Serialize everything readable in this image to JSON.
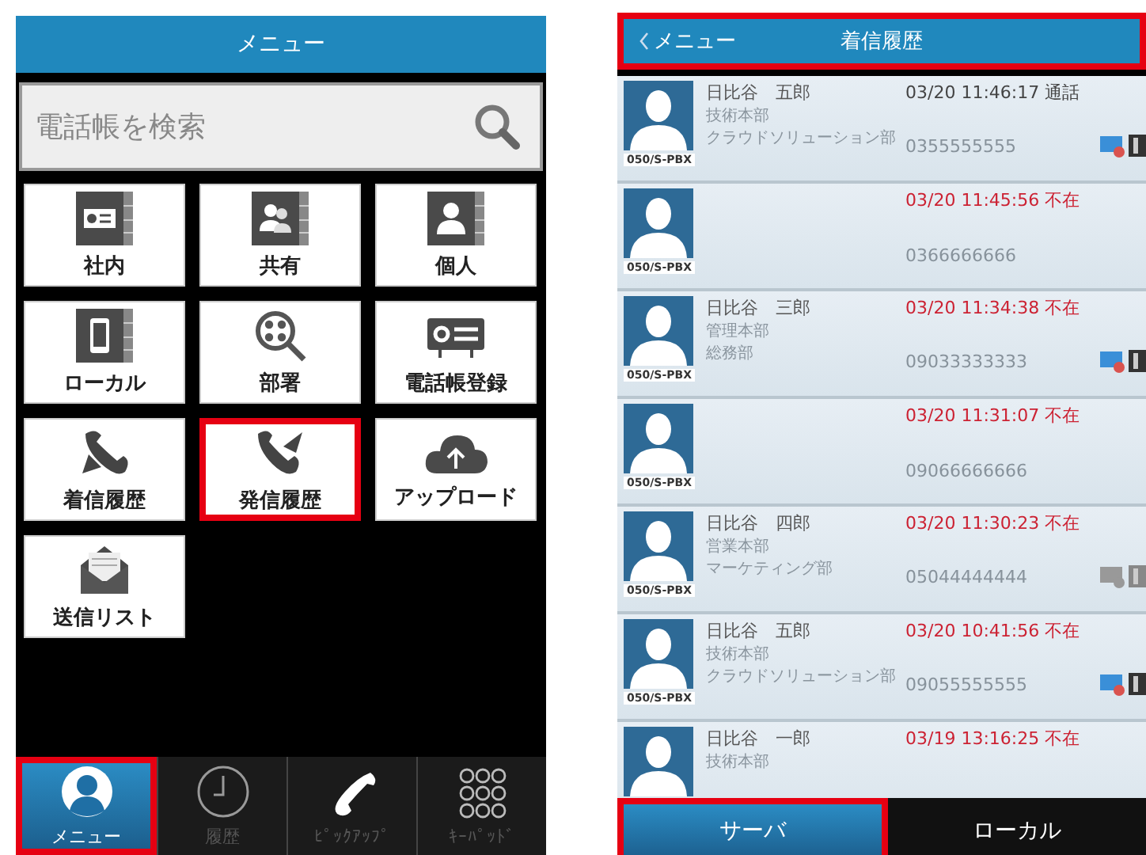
{
  "menu_screen": {
    "title": "メニュー",
    "search": {
      "placeholder": "電話帳を検索"
    },
    "tiles": [
      {
        "label": "社内",
        "highlighted": false
      },
      {
        "label": "共有",
        "highlighted": false
      },
      {
        "label": "個人",
        "highlighted": false
      },
      {
        "label": "ローカル",
        "highlighted": false
      },
      {
        "label": "部署",
        "highlighted": false
      },
      {
        "label": "電話帳登録",
        "highlighted": false
      },
      {
        "label": "着信履歴",
        "highlighted": false
      },
      {
        "label": "発信履歴",
        "highlighted": true
      },
      {
        "label": "アップロード",
        "highlighted": false
      },
      {
        "label": "送信リスト",
        "highlighted": false
      }
    ],
    "bottom_nav": [
      {
        "label": "メニュー",
        "selected": true,
        "highlighted": true
      },
      {
        "label": "履歴",
        "selected": false,
        "highlighted": false
      },
      {
        "label": "ﾋﾟｯｸｱｯﾌﾟ",
        "selected": false,
        "highlighted": false
      },
      {
        "label": "ｷｰﾊﾟｯﾄﾞ",
        "selected": false,
        "highlighted": false
      }
    ]
  },
  "history_screen": {
    "back": "メニュー",
    "title": "着信履歴",
    "header_highlighted": true,
    "rows": [
      {
        "name": "日比谷　五郎",
        "dept": "技術本部",
        "section": "クラウドソリューション部",
        "time": "03/20 11:46:17 通話",
        "missed": false,
        "number": "0355555555",
        "badge": "050/S-PBX",
        "status_icons": true,
        "online": true
      },
      {
        "time": "03/20 11:45:56 不在",
        "missed": true,
        "number": "0366666666",
        "badge": "050/S-PBX",
        "status_icons": false
      },
      {
        "name": "日比谷　三郎",
        "dept": "管理本部",
        "section": "総務部",
        "time": "03/20 11:34:38 不在",
        "missed": true,
        "number": "09033333333",
        "badge": "050/S-PBX",
        "status_icons": true,
        "online": true
      },
      {
        "time": "03/20 11:31:07 不在",
        "missed": true,
        "number": "09066666666",
        "badge": "050/S-PBX",
        "status_icons": false
      },
      {
        "name": "日比谷　四郎",
        "dept": "営業本部",
        "section": "マーケティング部",
        "time": "03/20 11:30:23 不在",
        "missed": true,
        "number": "05044444444",
        "badge": "050/S-PBX",
        "status_icons": true,
        "online": false
      },
      {
        "name": "日比谷　五郎",
        "dept": "技術本部",
        "section": "クラウドソリューション部",
        "time": "03/20 10:41:56 不在",
        "missed": true,
        "number": "09055555555",
        "badge": "050/S-PBX",
        "status_icons": true,
        "online": true
      },
      {
        "name": "日比谷　一郎",
        "dept": "技術本部",
        "time": "03/19 13:16:25 不在",
        "missed": true
      }
    ],
    "tabs": [
      {
        "label": "サーバ",
        "selected": true,
        "highlighted": true
      },
      {
        "label": "ローカル",
        "selected": false,
        "highlighted": false
      }
    ]
  }
}
